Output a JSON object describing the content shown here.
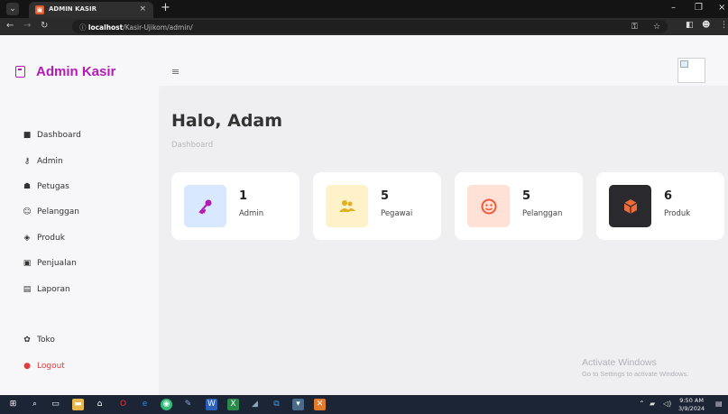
{
  "browser": {
    "tab_title": "ADMIN KASIR",
    "tab_close": "×",
    "new_tab": "+",
    "url_host": "localhost",
    "url_path": "/Kasir-Ujikom/admin/",
    "controls": {
      "minimize": "–",
      "maximize": "❐",
      "close": "×"
    }
  },
  "app": {
    "brand": "Admin Kasir",
    "accent_color": "#b31bb5",
    "sidebar": {
      "items": [
        {
          "label": "Dashboard",
          "icon": "grid-icon"
        },
        {
          "label": "Admin",
          "icon": "key-icon"
        },
        {
          "label": "Petugas",
          "icon": "users-icon"
        },
        {
          "label": "Pelanggan",
          "icon": "smile-icon"
        },
        {
          "label": "Produk",
          "icon": "box-icon"
        },
        {
          "label": "Penjualan",
          "icon": "cart-icon"
        },
        {
          "label": "Laporan",
          "icon": "document-icon"
        },
        {
          "label": "Toko",
          "icon": "gear-icon"
        },
        {
          "label": "Logout",
          "icon": "logout-icon"
        }
      ]
    },
    "header": {
      "menu_icon": "≡"
    },
    "main": {
      "title": "Halo, Adam",
      "breadcrumb": "Dashboard",
      "cards": [
        {
          "value": "1",
          "label": "Admin",
          "icon": "key-icon",
          "bg": "#d8e9ff",
          "fg": "#b31bb5"
        },
        {
          "value": "5",
          "label": "Pegawai",
          "icon": "users-icon",
          "bg": "#fff2c8",
          "fg": "#e0b020"
        },
        {
          "value": "5",
          "label": "Pelanggan",
          "icon": "smile-icon",
          "bg": "#ffe1d6",
          "fg": "#ee5a3a"
        },
        {
          "value": "6",
          "label": "Produk",
          "icon": "box-icon",
          "bg": "#2a2a2e",
          "fg": "#f06a3a"
        }
      ]
    }
  },
  "watermark": {
    "line1": "Activate Windows",
    "line2": "Go to Settings to activate Windows."
  },
  "taskbar": {
    "time": "9:50 AM",
    "date": "3/9/2024"
  }
}
